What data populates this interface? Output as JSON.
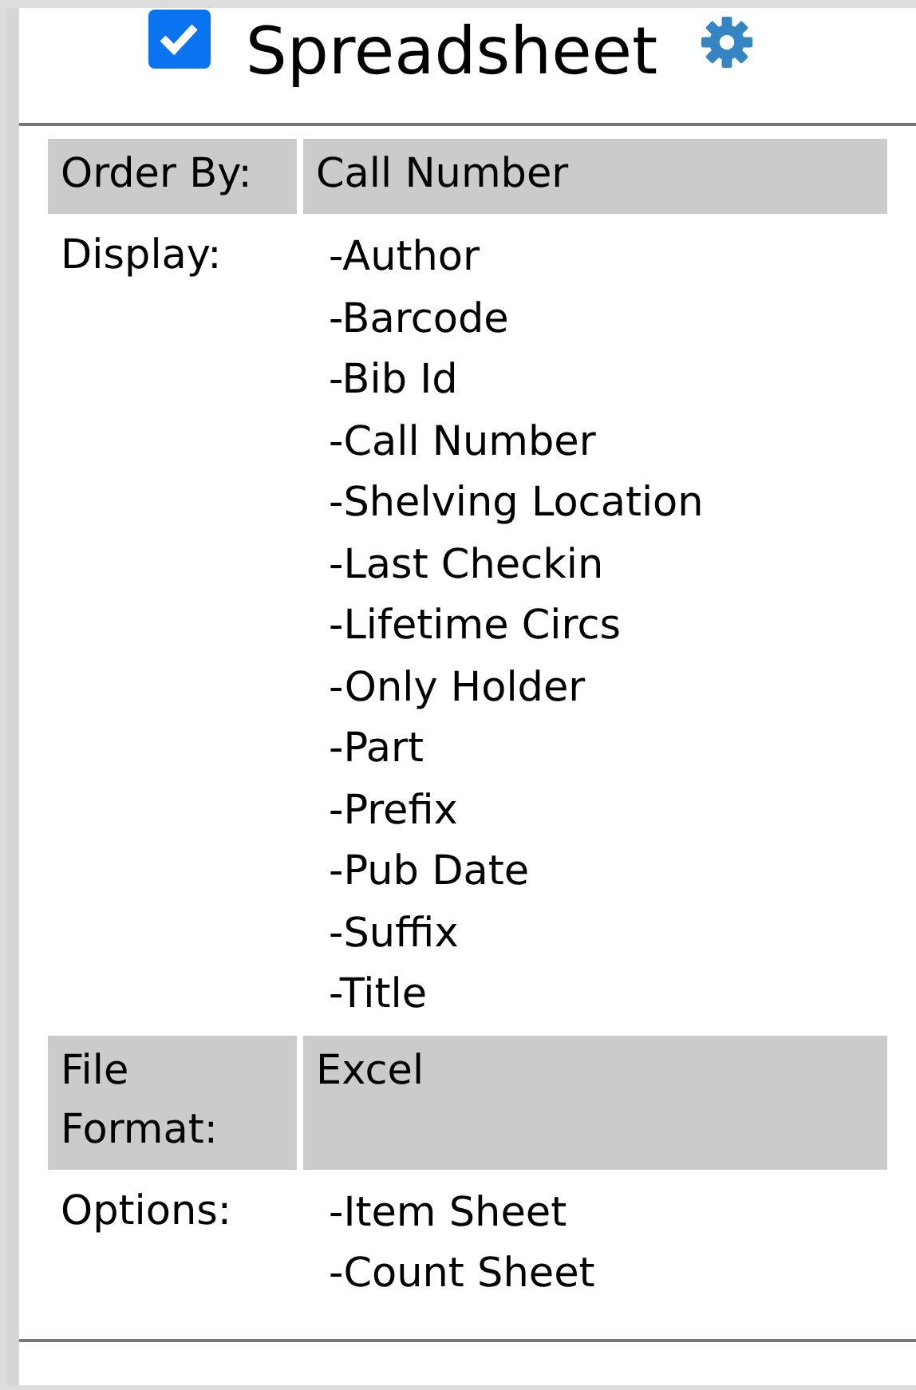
{
  "header": {
    "checked": true,
    "title": "Spreadsheet"
  },
  "rows": [
    {
      "kind": "single",
      "label": "Order By:",
      "value": "Call Number"
    },
    {
      "kind": "list",
      "label": "Display:",
      "items": [
        "-Author",
        "-Barcode",
        "-Bib Id",
        "-Call Number",
        "-Shelving Location",
        "-Last Checkin",
        "-Lifetime Circs",
        "-Only Holder",
        "-Part",
        "-Prefix",
        "-Pub Date",
        "-Suffix",
        "-Title"
      ]
    },
    {
      "kind": "single",
      "label": "File Format:",
      "value": "Excel"
    },
    {
      "kind": "list",
      "label": "Options:",
      "items": [
        "-Item Sheet",
        "-Count Sheet"
      ]
    }
  ]
}
